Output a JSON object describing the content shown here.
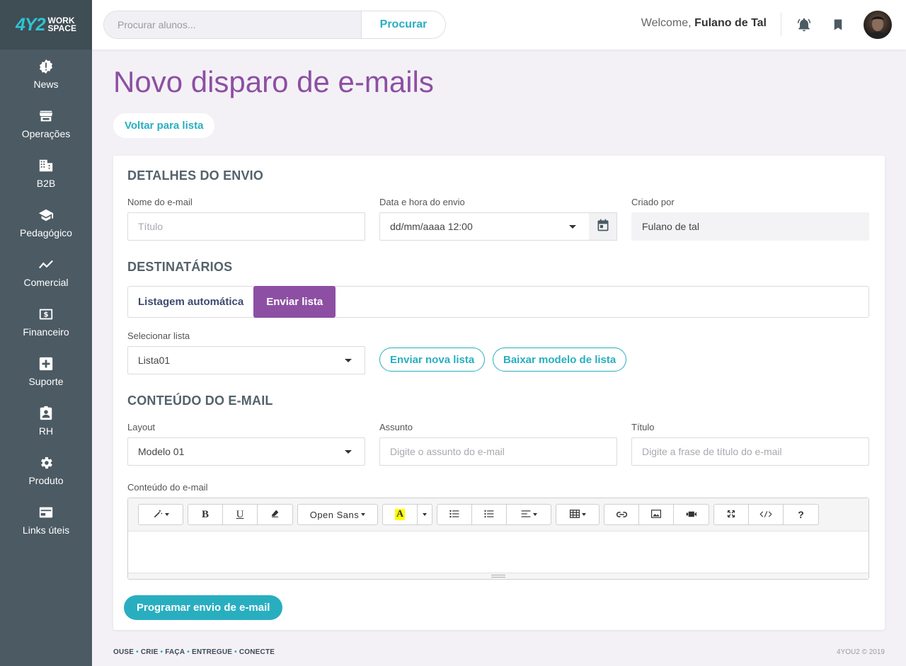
{
  "brand": {
    "mark": "4Y2",
    "line1": "WORK",
    "line2": "SPACE"
  },
  "sidebar": {
    "items": [
      {
        "label": "News",
        "icon": "alert-badge-icon"
      },
      {
        "label": "Operações",
        "icon": "store-icon"
      },
      {
        "label": "B2B",
        "icon": "building-icon"
      },
      {
        "label": "Pedagógico",
        "icon": "graduation-cap-icon"
      },
      {
        "label": "Comercial",
        "icon": "trend-line-icon"
      },
      {
        "label": "Financeiro",
        "icon": "money-icon"
      },
      {
        "label": "Suporte",
        "icon": "plus-box-icon"
      },
      {
        "label": "RH",
        "icon": "id-badge-icon"
      },
      {
        "label": "Produto",
        "icon": "gear-icon"
      },
      {
        "label": "Links úteis",
        "icon": "card-icon"
      }
    ]
  },
  "header": {
    "search_placeholder": "Procurar alunos...",
    "search_button": "Procurar",
    "welcome_prefix": "Welcome,",
    "user_name": "Fulano de Tal"
  },
  "page": {
    "title": "Novo disparo de e-mails",
    "back_button": "Voltar para lista"
  },
  "details": {
    "section_title": "DETALHES DO ENVIO",
    "name_label": "Nome do e-mail",
    "name_placeholder": "Título",
    "date_label": "Data e hora do envio",
    "date_value": "dd/mm/aaaa 12:00",
    "created_by_label": "Criado por",
    "created_by_value": "Fulano de tal"
  },
  "recipients": {
    "section_title": "DESTINATÁRIOS",
    "tabs": [
      {
        "label": "Listagem automática",
        "active": false
      },
      {
        "label": "Enviar lista",
        "active": true
      }
    ],
    "list_label": "Selecionar lista",
    "list_value": "Lista01",
    "upload_button": "Enviar nova lista",
    "download_button": "Baixar modelo de lista"
  },
  "content": {
    "section_title": "CONTEÚDO DO E-MAIL",
    "layout_label": "Layout",
    "layout_value": "Modelo 01",
    "subject_label": "Assunto",
    "subject_placeholder": "Digite o assunto do e-mail",
    "title_label": "Título",
    "title_placeholder": "Digite a frase de título do e-mail",
    "body_label": "Conteúdo do e-mail",
    "font_name": "Open Sans",
    "help_label": "?"
  },
  "submit_button": "Programar envio de e-mail",
  "footer": {
    "words": [
      "OUSE",
      "CRIE",
      "FAÇA",
      "ENTREGUE",
      "CONECTE"
    ],
    "copyright": "4YOU2 © 2019"
  },
  "colors": {
    "accent_teal": "#29aec0",
    "accent_purple": "#8d4fa3",
    "sidebar": "#4b5a63"
  }
}
